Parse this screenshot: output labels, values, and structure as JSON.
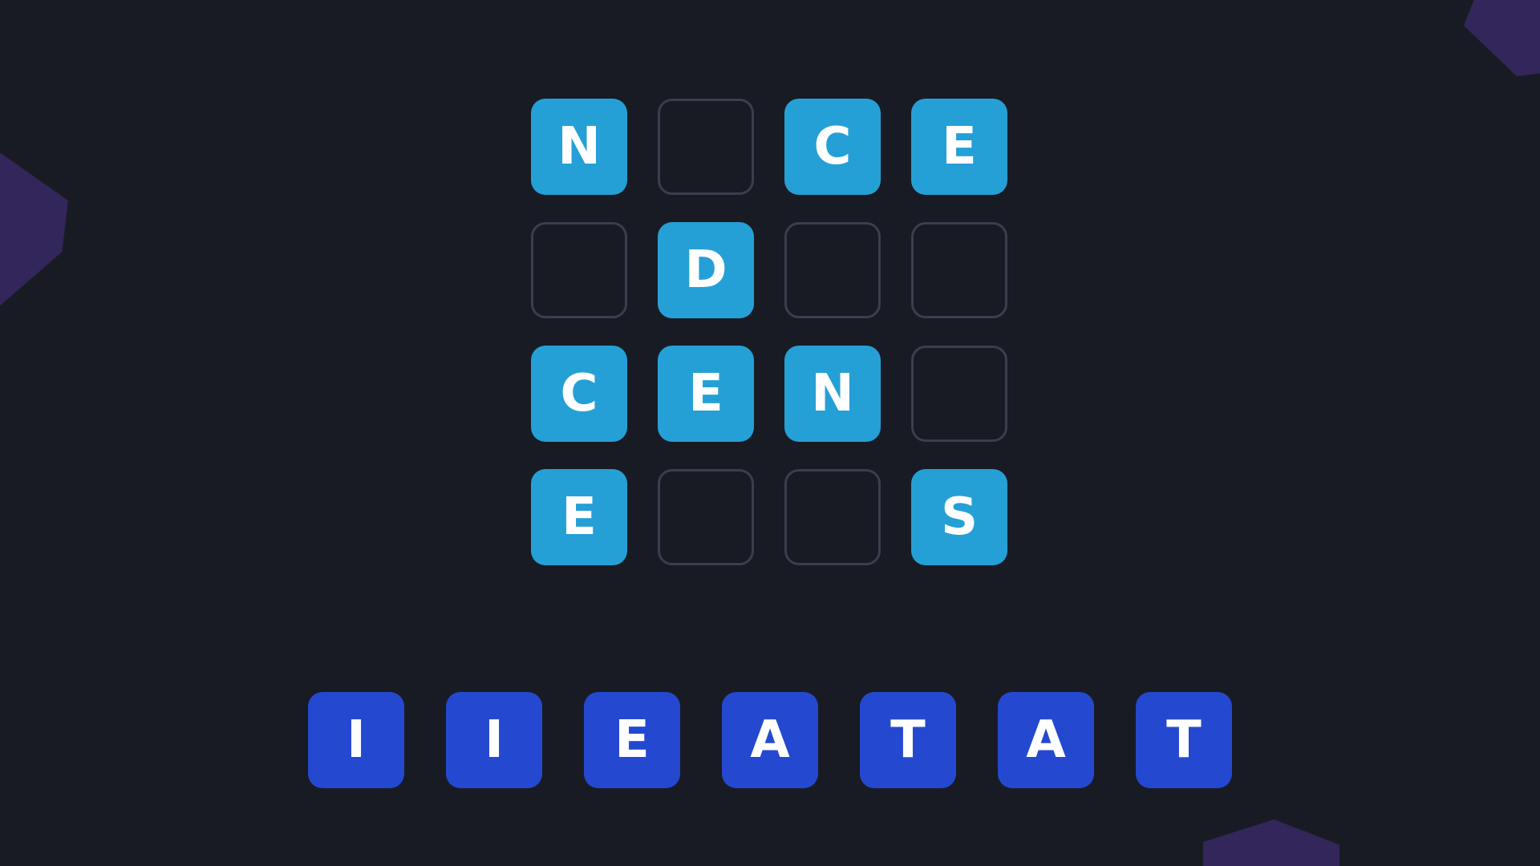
{
  "colors": {
    "background": "#181b24",
    "filled_cell": "#25a0d6",
    "empty_cell_border": "#3a3e4e",
    "tray_tile": "#2449d0",
    "letter": "#ffffff",
    "decoration": "#33265a"
  },
  "board": {
    "rows": [
      [
        "N",
        "",
        "C",
        "E"
      ],
      [
        "",
        "D",
        "",
        ""
      ],
      [
        "C",
        "E",
        "N",
        ""
      ],
      [
        "E",
        "",
        "",
        "S"
      ]
    ]
  },
  "tray": {
    "letters": [
      "I",
      "I",
      "E",
      "A",
      "T",
      "A",
      "T"
    ]
  }
}
